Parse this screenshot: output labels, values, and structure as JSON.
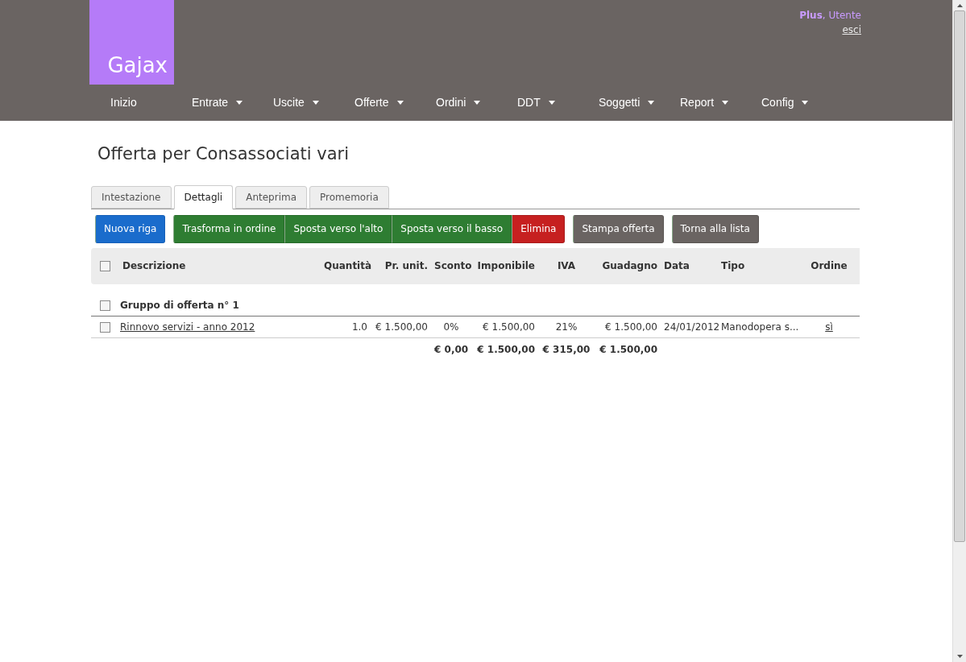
{
  "header": {
    "logo": "Gajax",
    "user": {
      "label": "**Plus**, Utente",
      "logout": "esci"
    }
  },
  "nav": [
    {
      "label": "Inizio",
      "dropdown": false
    },
    {
      "label": "Entrate",
      "dropdown": true
    },
    {
      "label": "Uscite",
      "dropdown": true
    },
    {
      "label": "Offerte",
      "dropdown": true
    },
    {
      "label": "Ordini",
      "dropdown": true
    },
    {
      "label": "DDT",
      "dropdown": true
    },
    {
      "label": "Soggetti",
      "dropdown": true
    },
    {
      "label": "Report",
      "dropdown": true
    },
    {
      "label": "Config",
      "dropdown": true
    }
  ],
  "page_title": "Offerta per Consassociati vari",
  "tabs": [
    {
      "label": "Intestazione",
      "selected": false
    },
    {
      "label": "Dettagli",
      "selected": true
    },
    {
      "label": "Anteprima",
      "selected": false
    },
    {
      "label": "Promemoria",
      "selected": false
    }
  ],
  "button_groups": [
    [
      {
        "label": "Nuova riga",
        "kind": "primary"
      }
    ],
    [
      {
        "label": "Trasforma in ordine",
        "kind": "success"
      },
      {
        "label": "Sposta verso l'alto",
        "kind": "success"
      },
      {
        "label": "Sposta verso il basso",
        "kind": "success"
      },
      {
        "label": "Elimina",
        "kind": "danger"
      }
    ],
    [
      {
        "label": "Stampa offerta",
        "kind": "neutral"
      }
    ],
    [
      {
        "label": "Torna alla lista",
        "kind": "neutral"
      }
    ]
  ],
  "table": {
    "select_all_checked": false,
    "columns": [
      "Descrizione",
      "Quantità",
      "Pr. unit.",
      "Sconto",
      "Imponibile",
      "IVA",
      "Guadagno",
      "Data",
      "Tipo",
      "Ordine"
    ],
    "rows": [
      {
        "kind": "group",
        "checked": false,
        "cells": [
          "Gruppo di offerta n° 1"
        ]
      },
      {
        "kind": "item",
        "checked": false,
        "cells": [
          "Rinnovo servizi - anno 2012",
          "1.0",
          "€ 1.500,00",
          "0%",
          "€ 1.500,00",
          "21%",
          "€ 1.500,00",
          "24/01/2012",
          "Manodopera s...",
          "sì"
        ]
      }
    ],
    "totals": {
      "sconto": "€ 0,00",
      "imponibile": "€ 1.500,00",
      "iva": "€ 315,00",
      "guadagno": "€ 1.500,00"
    }
  }
}
